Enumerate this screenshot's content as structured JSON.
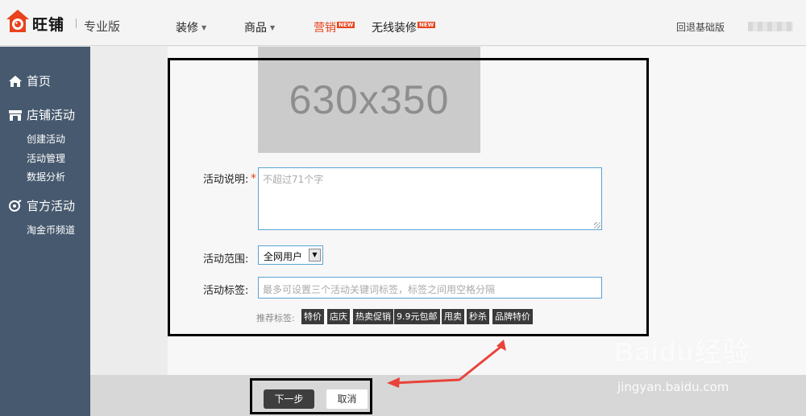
{
  "header": {
    "brand": "旺铺",
    "edition": "专业版",
    "nav": [
      {
        "label": "装修",
        "has_caret": true,
        "is_new": false,
        "active": false
      },
      {
        "label": "商品",
        "has_caret": true,
        "is_new": false,
        "active": false
      },
      {
        "label": "营销",
        "has_caret": false,
        "is_new": true,
        "active": true
      },
      {
        "label": "无线装修",
        "has_caret": false,
        "is_new": true,
        "active": false
      }
    ],
    "new_badge": "NEW",
    "back_link": "回退基础版"
  },
  "sidebar": {
    "home": "首页",
    "shop_activity": "店铺活动",
    "shop_activity_items": [
      "创建活动",
      "活动管理",
      "数据分析"
    ],
    "official_activity": "官方活动",
    "official_activity_items": [
      "淘金币频道"
    ]
  },
  "form": {
    "image_placeholder": "630x350",
    "desc_label": "活动说明:",
    "desc_required": "*",
    "desc_placeholder": "不超过71个字",
    "range_label": "活动范围:",
    "range_value": "全网用户",
    "tags_label": "活动标签:",
    "tags_placeholder": "最多可设置三个活动关键词标签，标签之间用空格分隔",
    "recommended_label": "推荐标签:",
    "recommended_tags": [
      "特价",
      "店庆",
      "热卖促销",
      "9.9元包邮",
      "甩卖",
      "秒杀",
      "品牌特价"
    ]
  },
  "actions": {
    "next": "下一步",
    "cancel": "取消"
  },
  "watermark": {
    "logo": "Baidu经验",
    "url": "jingyan.baidu.com"
  },
  "colors": {
    "accent": "#e8431c",
    "sidebar": "#46596e",
    "input_border": "#5aa4d4",
    "annotation_arrow": "#e8433a"
  }
}
